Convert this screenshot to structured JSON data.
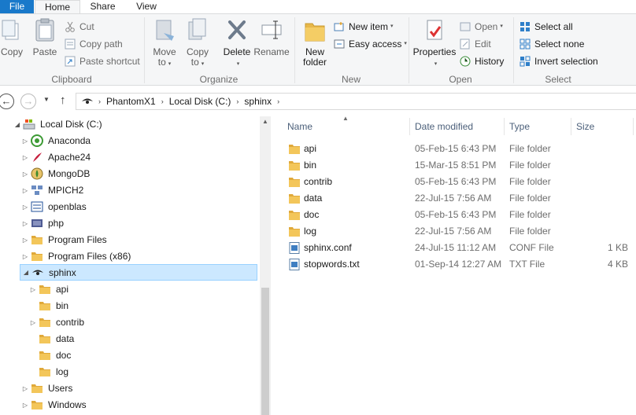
{
  "tabs": {
    "file": "File",
    "home": "Home",
    "share": "Share",
    "view": "View"
  },
  "ribbon": {
    "clipboard": {
      "label": "Clipboard",
      "copy": "Copy",
      "paste": "Paste",
      "cut": "Cut",
      "copy_path": "Copy path",
      "paste_shortcut": "Paste shortcut"
    },
    "organize": {
      "label": "Organize",
      "move_to": "Move",
      "move_to2": "to",
      "copy_to": "Copy",
      "copy_to2": "to",
      "delete": "Delete",
      "rename": "Rename"
    },
    "new": {
      "label": "New",
      "new_folder": "New",
      "new_folder2": "folder",
      "new_item": "New item",
      "easy_access": "Easy access"
    },
    "open": {
      "label": "Open",
      "properties": "Properties",
      "open": "Open",
      "edit": "Edit",
      "history": "History"
    },
    "select": {
      "label": "Select",
      "select_all": "Select all",
      "select_none": "Select none",
      "invert_selection": "Invert selection"
    }
  },
  "address": {
    "crumbs": [
      "PhantomX1",
      "Local Disk (C:)",
      "sphinx"
    ]
  },
  "tree": {
    "root": "Local Disk (C:)",
    "items": [
      "Anaconda",
      "Apache24",
      "MongoDB",
      "MPICH2",
      "openblas",
      "php",
      "Program Files",
      "Program Files (x86)",
      "sphinx"
    ],
    "children": [
      "api",
      "bin",
      "contrib",
      "data",
      "doc",
      "log"
    ],
    "after": [
      "Users",
      "Windows"
    ]
  },
  "columns": {
    "name": "Name",
    "date": "Date modified",
    "type": "Type",
    "size": "Size"
  },
  "files": [
    {
      "name": "api",
      "date": "05-Feb-15 6:43 PM",
      "type": "File folder",
      "size": ""
    },
    {
      "name": "bin",
      "date": "15-Mar-15 8:51 PM",
      "type": "File folder",
      "size": ""
    },
    {
      "name": "contrib",
      "date": "05-Feb-15 6:43 PM",
      "type": "File folder",
      "size": ""
    },
    {
      "name": "data",
      "date": "22-Jul-15 7:56 AM",
      "type": "File folder",
      "size": ""
    },
    {
      "name": "doc",
      "date": "05-Feb-15 6:43 PM",
      "type": "File folder",
      "size": ""
    },
    {
      "name": "log",
      "date": "22-Jul-15 7:56 AM",
      "type": "File folder",
      "size": ""
    },
    {
      "name": "sphinx.conf",
      "date": "24-Jul-15 11:12 AM",
      "type": "CONF File",
      "size": "1 KB"
    },
    {
      "name": "stopwords.txt",
      "date": "01-Sep-14 12:27 AM",
      "type": "TXT File",
      "size": "4 KB"
    }
  ],
  "colors": {
    "accent": "#1979ca",
    "selection": "#cce8ff",
    "folder": "#e8b84a"
  }
}
